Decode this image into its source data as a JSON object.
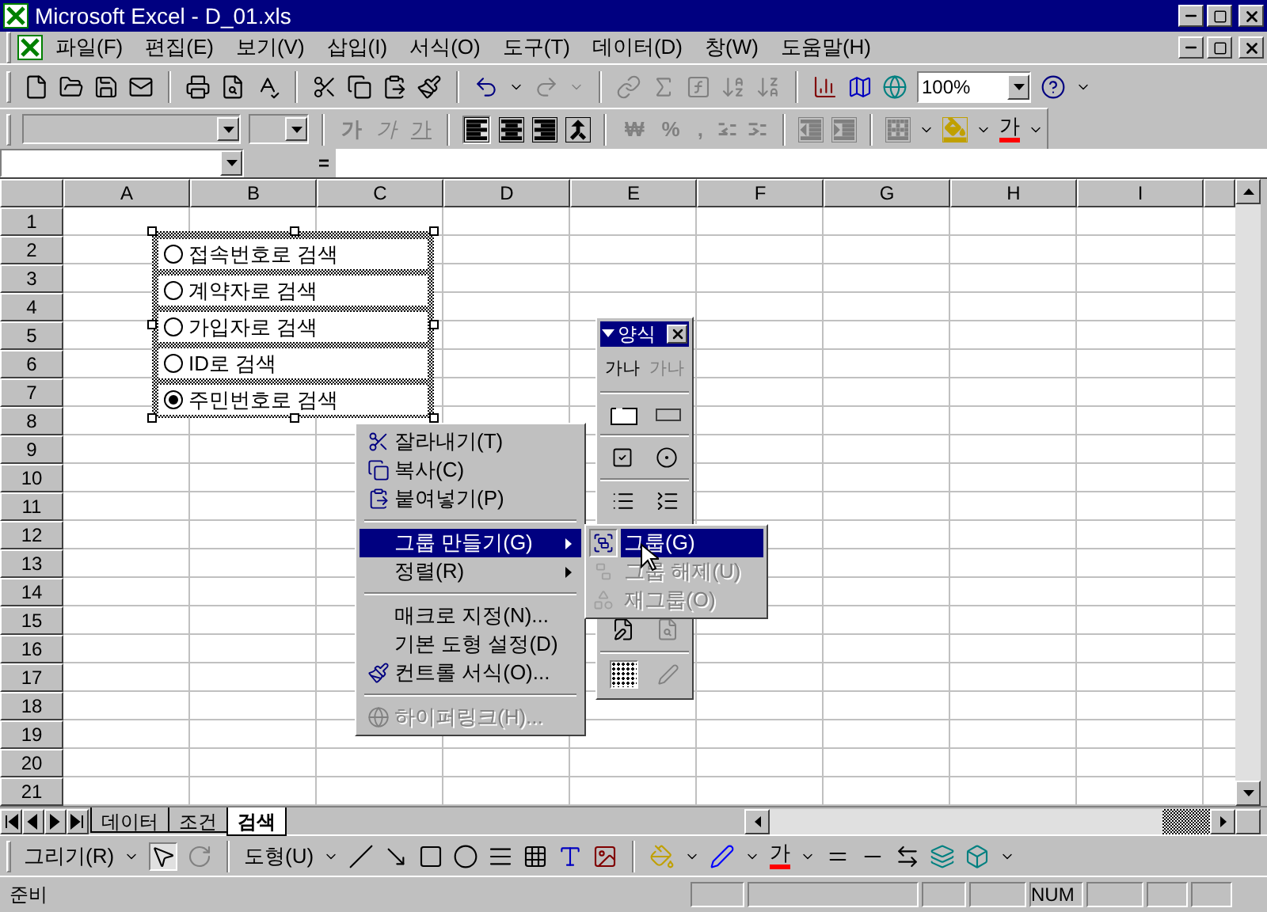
{
  "window": {
    "title": "Microsoft Excel - D_01.xls"
  },
  "menu_bar": {
    "items": [
      "파일(F)",
      "편집(E)",
      "보기(V)",
      "삽입(I)",
      "서식(O)",
      "도구(T)",
      "데이터(D)",
      "창(W)",
      "도움말(H)"
    ]
  },
  "standard_toolbar": {
    "zoom": "100%"
  },
  "formatting_toolbar": {
    "style_buttons": [
      "가",
      "가",
      "가"
    ],
    "number_buttons": [
      "₩",
      "%",
      ","
    ],
    "font_color_button": "가"
  },
  "formula_bar": {
    "equals": "="
  },
  "sheet": {
    "columns": [
      "A",
      "B",
      "C",
      "D",
      "E",
      "F",
      "G",
      "H",
      "I"
    ],
    "rows": [
      "1",
      "2",
      "3",
      "4",
      "5",
      "6",
      "7",
      "8",
      "9",
      "10",
      "11",
      "12",
      "13",
      "14",
      "15",
      "16",
      "17",
      "18",
      "19",
      "20",
      "21"
    ]
  },
  "option_buttons": [
    {
      "label": "접속번호로 검색",
      "selected": false
    },
    {
      "label": "계약자로 검색",
      "selected": false
    },
    {
      "label": "가입자로 검색",
      "selected": false
    },
    {
      "label": "ID로 검색",
      "selected": false
    },
    {
      "label": "주민번호로 검색",
      "selected": true
    }
  ],
  "context_menu": {
    "items": [
      {
        "kind": "item",
        "label": "잘라내기(T)",
        "submenu": false,
        "disabled": false,
        "selected": false
      },
      {
        "kind": "item",
        "label": "복사(C)",
        "submenu": false,
        "disabled": false,
        "selected": false
      },
      {
        "kind": "item",
        "label": "붙여넣기(P)",
        "submenu": false,
        "disabled": false,
        "selected": false
      },
      {
        "kind": "separator"
      },
      {
        "kind": "item",
        "label": "그룹 만들기(G)",
        "submenu": true,
        "disabled": false,
        "selected": true
      },
      {
        "kind": "item",
        "label": "정렬(R)",
        "submenu": true,
        "disabled": false,
        "selected": false
      },
      {
        "kind": "separator"
      },
      {
        "kind": "item",
        "label": "매크로 지정(N)...",
        "submenu": false,
        "disabled": false,
        "selected": false
      },
      {
        "kind": "item",
        "label": "기본 도형 설정(D)",
        "submenu": false,
        "disabled": false,
        "selected": false
      },
      {
        "kind": "item",
        "label": "컨트롤 서식(O)...",
        "submenu": false,
        "disabled": false,
        "selected": false
      },
      {
        "kind": "separator"
      },
      {
        "kind": "item",
        "label": "하이퍼링크(H)...",
        "submenu": false,
        "disabled": true,
        "selected": false
      }
    ]
  },
  "submenu": {
    "items": [
      {
        "label": "그룹(G)",
        "disabled": false,
        "selected": true
      },
      {
        "label": "그룹 해제(U)",
        "disabled": true,
        "selected": false
      },
      {
        "label": "재그룹(O)",
        "disabled": true,
        "selected": false
      }
    ]
  },
  "forms_toolbar": {
    "title": "양식",
    "label_button": "가나",
    "edit_box_button": "가나"
  },
  "sheet_tabs": [
    {
      "label": "데이터",
      "selected": false
    },
    {
      "label": "조건",
      "selected": false
    },
    {
      "label": "검색",
      "selected": true
    }
  ],
  "drawing_toolbar": {
    "draw_menu": "그리기(R)",
    "autoshapes_menu": "도형(U)",
    "font_color_button": "가"
  },
  "status_bar": {
    "text": "준비",
    "indicators": [
      "NUM"
    ]
  }
}
